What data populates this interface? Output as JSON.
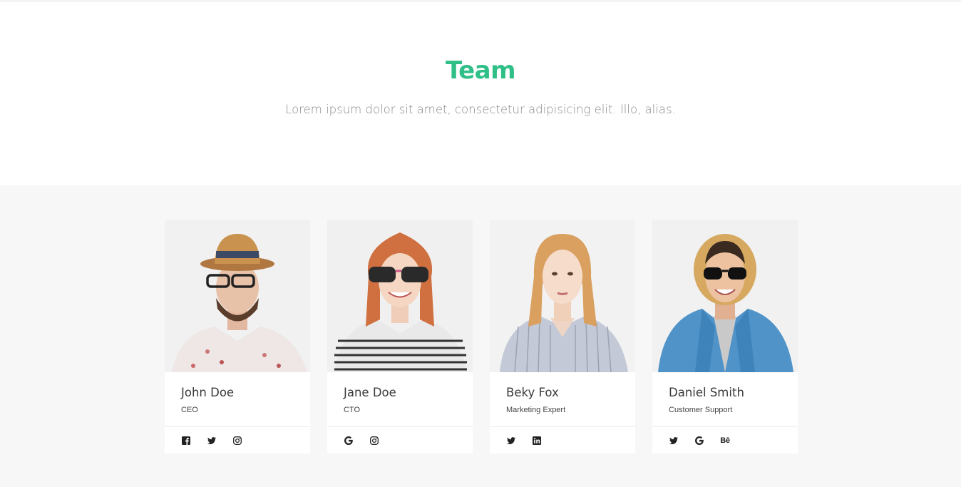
{
  "hero": {
    "title": "Team",
    "subtitle": "Lorem ipsum dolor sit amet, consectetur adipisicing elit. Illo, alias."
  },
  "colors": {
    "accent": "#2fbf87",
    "section_bg": "#f7f7f7"
  },
  "team": [
    {
      "name": "John Doe",
      "role": "CEO",
      "socials": [
        "facebook-icon",
        "twitter-icon",
        "instagram-icon"
      ]
    },
    {
      "name": "Jane Doe",
      "role": "CTO",
      "socials": [
        "google-icon",
        "instagram-icon"
      ]
    },
    {
      "name": "Beky Fox",
      "role": "Marketing Expert",
      "socials": [
        "twitter-icon",
        "linkedin-icon"
      ]
    },
    {
      "name": "Daniel Smith",
      "role": "Customer Support",
      "socials": [
        "twitter-icon",
        "google-icon",
        "behance-icon"
      ]
    }
  ]
}
